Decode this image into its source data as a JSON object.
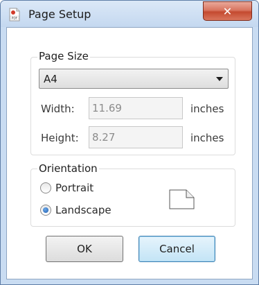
{
  "window": {
    "title": "Page Setup",
    "close_symbol": "✕"
  },
  "page_size": {
    "legend": "Page Size",
    "selected": "A4",
    "width_label": "Width:",
    "width_value": "11.69",
    "height_label": "Height:",
    "height_value": "8.27",
    "unit": "inches"
  },
  "orientation": {
    "legend": "Orientation",
    "options": [
      {
        "label": "Portrait",
        "checked": false
      },
      {
        "label": "Landscape",
        "checked": true
      }
    ]
  },
  "buttons": {
    "ok": "OK",
    "cancel": "Cancel"
  },
  "colors": {
    "accent": "#3c7fb1",
    "close": "#c44a30",
    "title_bg": "#c9dcf2"
  }
}
